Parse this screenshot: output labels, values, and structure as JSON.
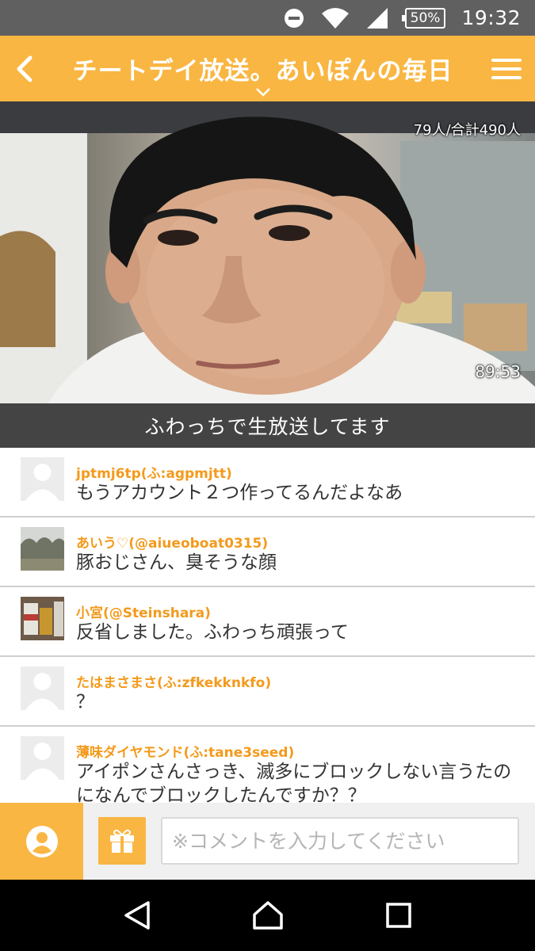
{
  "status_bar": {
    "battery": "50%",
    "time": "19:32",
    "icons": [
      "do-not-disturb-icon",
      "wifi-icon",
      "cell-signal-icon",
      "battery-icon"
    ]
  },
  "header": {
    "title": "チートデイ放送。あいぽんの毎日",
    "icons": [
      "back-arrow-icon",
      "chevron-down-icon",
      "hamburger-menu-icon"
    ]
  },
  "video": {
    "viewers": "79人/合計490人",
    "elapsed": "89:53"
  },
  "banner": {
    "text": "ふわっちで生放送してます"
  },
  "comments": [
    {
      "name": "jptmj6tp(ふ:agpmjtt)",
      "text": "もうアカウント２つ作ってるんだよなあ",
      "avatar": "default"
    },
    {
      "name": "あいう♡(@aiueoboat0315)",
      "text": "豚おじさん、臭そうな顔",
      "avatar": "photo-trees"
    },
    {
      "name": "小宮(@Steinshara)",
      "text": "反省しました。ふわっち頑張って",
      "avatar": "photo-cans"
    },
    {
      "name": "たはまさまさ(ふ:zfkekknkfo)",
      "text": "？",
      "avatar": "default"
    },
    {
      "name": "薄味ダイヤモンド(ふ:tane3seed)",
      "text": "アイポンさんさっき、滅多にブロックしない言うたのになんでブロックしたんですか？？",
      "avatar": "default"
    }
  ],
  "input": {
    "placeholder": "※コメントを入力してください"
  },
  "colors": {
    "accent": "#f9b642",
    "name_text": "#f39a1c",
    "status_bar": "#606060",
    "banner": "#444444"
  },
  "nav": {
    "icons": [
      "back-triangle-icon",
      "home-icon",
      "recents-square-icon"
    ]
  }
}
